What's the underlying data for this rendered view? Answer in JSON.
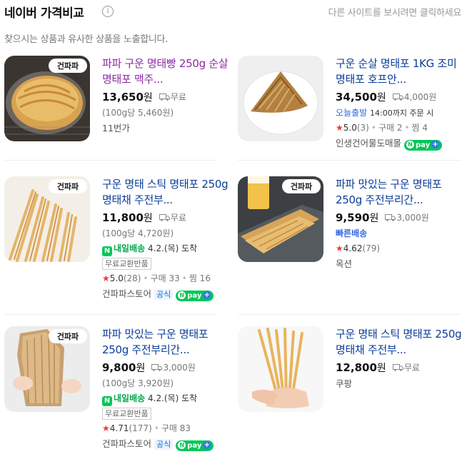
{
  "header": {
    "title": "네이버 가격비교",
    "info_glyph": "i",
    "other_sites": "다른 사이트를 보시려면 클릭하세요"
  },
  "subtitle": "찾으시는 상품과 유사한 상품을 노출합니다.",
  "colors": {
    "link": "#0a3c99",
    "visited": "#8a2aa3",
    "naver_green": "#03c75a",
    "star": "#f3363b"
  },
  "products": [
    {
      "name": "파파 구운 명태빵 250g 순살 명태포 맥주...",
      "price": "13,650",
      "won": "원",
      "shipping": "무료",
      "unit_price": "(100g당 5,460원)",
      "seller": "11번가"
    },
    {
      "name": "구운 순살 명태포 1KG 조미명태포 호프안...",
      "price": "34,500",
      "won": "원",
      "shipping": "4,000원",
      "delivery_label": "오늘출발",
      "delivery_text": "14:00까지 주문 시",
      "rating": "5.0",
      "rating_count": "(3)",
      "purchases": "구매 2",
      "wishes": "찜 4",
      "seller": "인생건어물도매몰",
      "npay": "pay"
    },
    {
      "name": "구운 명태 스틱 명태포 250g 명태채 주전부...",
      "price": "11,800",
      "won": "원",
      "shipping": "무료",
      "unit_price": "(100g당 4,720원)",
      "delivery_label": "내일배송",
      "delivery_date": "4.2.(목) 도착",
      "tag": "무료교환반품",
      "rating": "5.0",
      "rating_count": "(28)",
      "purchases": "구매 33",
      "wishes": "찜 16",
      "seller": "건파파스토어",
      "official": "공식",
      "npay": "pay"
    },
    {
      "name": "파파 맛있는 구운 명태포 250g 주전부리간...",
      "price": "9,590",
      "won": "원",
      "shipping": "3,000원",
      "fast": "빠른배송",
      "rating": "4.62",
      "rating_count": "(79)",
      "seller": "옥션"
    },
    {
      "name": "파파 맛있는 구운 명태포 250g 주전부리간...",
      "price": "9,800",
      "won": "원",
      "shipping": "3,000원",
      "unit_price": "(100g당 3,920원)",
      "delivery_label": "내일배송",
      "delivery_date": "4.2.(목) 도착",
      "tag": "무료교환반품",
      "rating": "4.71",
      "rating_count": "(177)",
      "purchases": "구매 83",
      "seller": "건파파스토어",
      "official": "공식",
      "npay": "pay"
    },
    {
      "name": "구운 명태 스틱 명태포 250g 명태채 주전부...",
      "price": "12,800",
      "won": "원",
      "shipping": "무료",
      "seller": "쿠팡"
    }
  ],
  "thumb_logo": "건파파",
  "npay_n": "N",
  "npay_plus": "+",
  "n_badge": "N",
  "star_glyph": "★"
}
